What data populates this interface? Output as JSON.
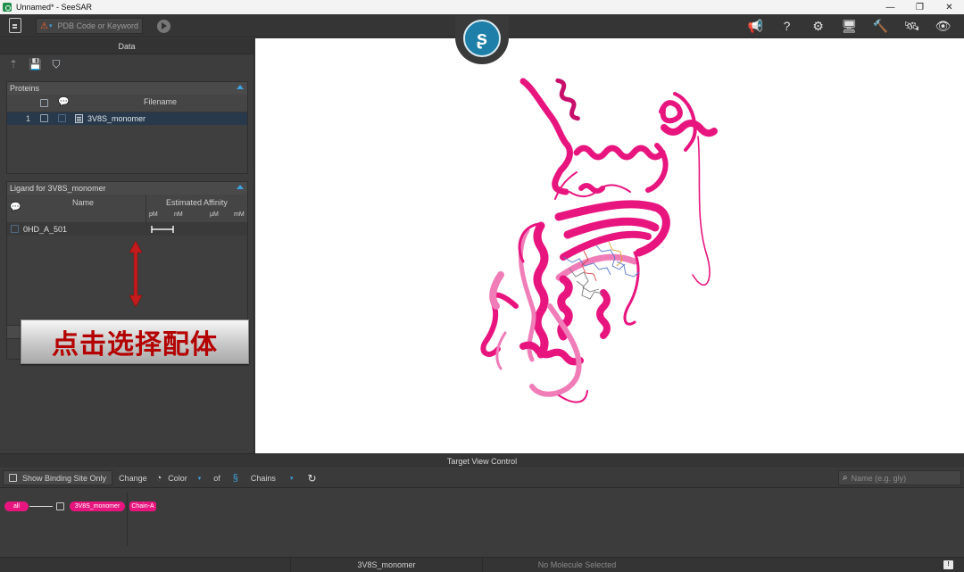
{
  "window": {
    "title": "Unnamed* - SeeSAR",
    "minimize": "—",
    "restore": "❐",
    "close": "✕"
  },
  "toolbar": {
    "search_placeholder": "PDB Code or Keyword",
    "warn_glyph": "⚠",
    "dropdown_glyph": "▾",
    "right_icons": [
      {
        "name": "megaphone-icon",
        "glyph": "📢"
      },
      {
        "name": "help-icon",
        "glyph": "?"
      },
      {
        "name": "settings-gear-icon",
        "glyph": "⚙"
      },
      {
        "name": "monitor-icon",
        "glyph": "🖥"
      },
      {
        "name": "tools-icon",
        "glyph": "🔨"
      },
      {
        "name": "satellite-icon",
        "glyph": "🛰"
      },
      {
        "name": "visibility-eye-icon",
        "glyph": "👁"
      }
    ]
  },
  "data_panel": {
    "title": "Data",
    "tool_glyphs": {
      "import": "⇡",
      "save": "💾",
      "filter": "⛉"
    }
  },
  "proteins": {
    "title": "Proteins",
    "columns": {
      "filename": "Filename"
    },
    "rows": [
      {
        "index": "1",
        "filename": "3V8S_monomer"
      }
    ]
  },
  "ligands": {
    "title": "Ligand for 3V8S_monomer",
    "columns": {
      "name": "Name",
      "affinity": "Estimated Affinity"
    },
    "units": [
      "pM",
      "nM",
      "µM",
      "mM"
    ],
    "rows": [
      {
        "name": "0HD_A_501"
      }
    ]
  },
  "annotation": {
    "caption": "点击选择配体",
    "arrow_color": "#c41c1c"
  },
  "logo": {
    "glyph": "ʂ"
  },
  "target_view": {
    "title": "Target View Control",
    "show_binding": "Show Binding Site Only",
    "change": "Change",
    "color": "Color",
    "of": "of",
    "chains": "Chains",
    "dropdown_glyph": "▾",
    "name_placeholder": "Name (e.g. gly)",
    "pills": {
      "all": "all",
      "protein": "3V8S_monomer",
      "chain": "Chain-A"
    }
  },
  "status": {
    "protein": "3V8S_monomer",
    "selection": "No Molecule Selected",
    "message_glyph": "!"
  },
  "colors": {
    "protein_ribbon": "#e8157f",
    "protein_ribbon_light": "#f07cb8",
    "accent_blue": "#3da3e0",
    "selection_row": "#27394b"
  }
}
